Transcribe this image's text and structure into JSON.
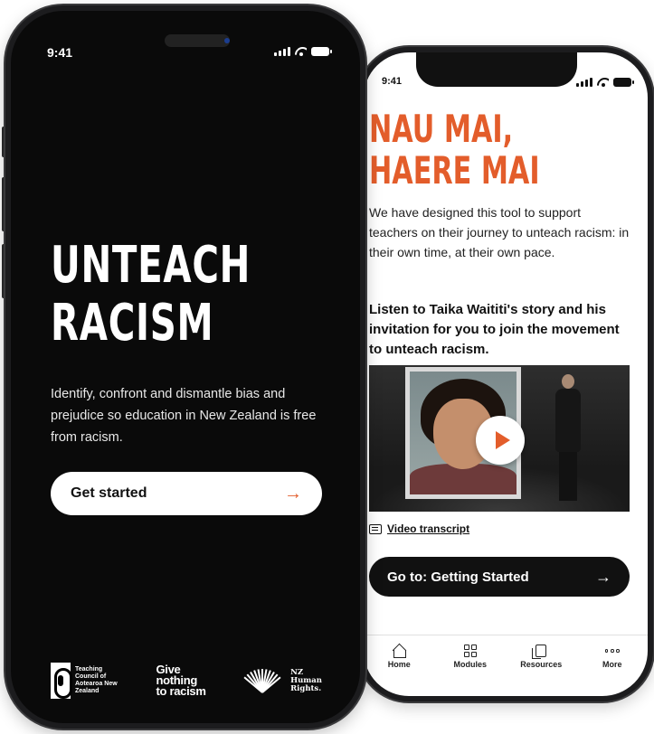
{
  "left_phone": {
    "status_time": "9:41",
    "hero_title_line1": "UNTEACH",
    "hero_title_line2": "RACISM",
    "description": "Identify, confront and dismantle bias and prejudice so education in New Zealand is free from racism.",
    "get_started_label": "Get started",
    "get_started_icon": "→",
    "logos": {
      "teaching_council": "Teaching Council of Aotearoa New Zealand",
      "give_nothing_line1": "Give",
      "give_nothing_line2": "nothing",
      "give_nothing_line3": "to racism",
      "human_rights_line1": "NZ",
      "human_rights_line2": "Human",
      "human_rights_line3": "Rights."
    }
  },
  "right_phone": {
    "status_time": "9:41",
    "title": "NAU MAI, HAERE MAI",
    "intro": "We have designed this tool to support teachers on their journey to unteach racism: in their own time, at their own pace.",
    "listen_text": "Listen to Taika Waititi's story and his invitation for you to join the movement to unteach racism.",
    "video_transcript_label": "Video transcript",
    "goto_button_label": "Go to: Getting Started",
    "goto_button_icon": "→",
    "tabs": [
      {
        "label": "Home",
        "icon": "home-icon"
      },
      {
        "label": "Modules",
        "icon": "modules-icon"
      },
      {
        "label": "Resources",
        "icon": "resources-icon"
      },
      {
        "label": "More",
        "icon": "more-icon"
      }
    ]
  },
  "colors": {
    "accent": "#e35d2b",
    "dark": "#0a0a0a",
    "light": "#ffffff"
  }
}
